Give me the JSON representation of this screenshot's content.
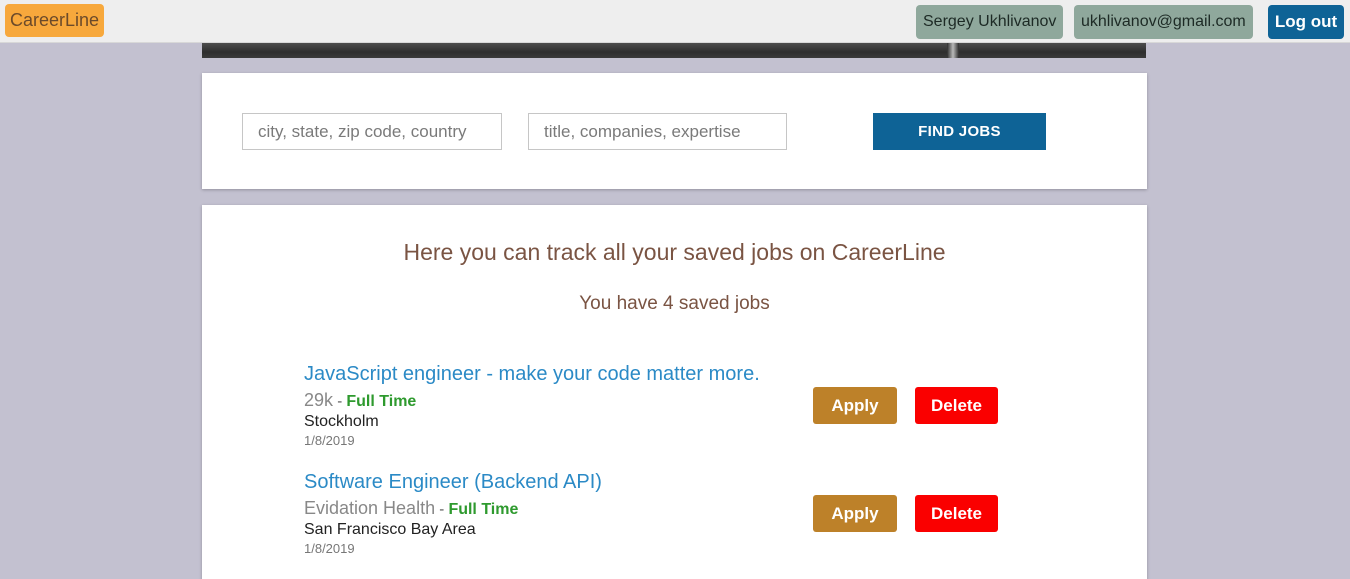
{
  "header": {
    "brand": "CareerLine",
    "user_name": "Sergey Ukhlivanov",
    "user_email": "ukhlivanov@gmail.com",
    "logout_label": "Log out"
  },
  "search": {
    "location_placeholder": "city, state, zip code, country",
    "keyword_placeholder": "title, companies, expertise",
    "find_label": "FIND JOBS"
  },
  "saved": {
    "headline": "Here you can track all your saved jobs on CareerLine",
    "count_text": "You have 4 saved jobs",
    "jobs": [
      {
        "title": "JavaScript engineer - make your code matter more.",
        "company": "29k",
        "separator": " - ",
        "type": "Full Time",
        "location": "Stockholm",
        "date": "1/8/2019",
        "apply_label": "Apply",
        "delete_label": "Delete"
      },
      {
        "title": "Software Engineer (Backend API)",
        "company": "Evidation Health",
        "separator": " - ",
        "type": "Full Time",
        "location": "San Francisco Bay Area",
        "date": "1/8/2019",
        "apply_label": "Apply",
        "delete_label": "Delete"
      }
    ]
  },
  "colors": {
    "page_bg": "#c3c1d0",
    "brand_bg": "#f7a83c",
    "primary_blue": "#0e6396",
    "apply": "#bd8129",
    "delete": "#fa0000",
    "job_title": "#2b8ac6",
    "full_time": "#2e9a2e",
    "heading": "#7a5443"
  }
}
